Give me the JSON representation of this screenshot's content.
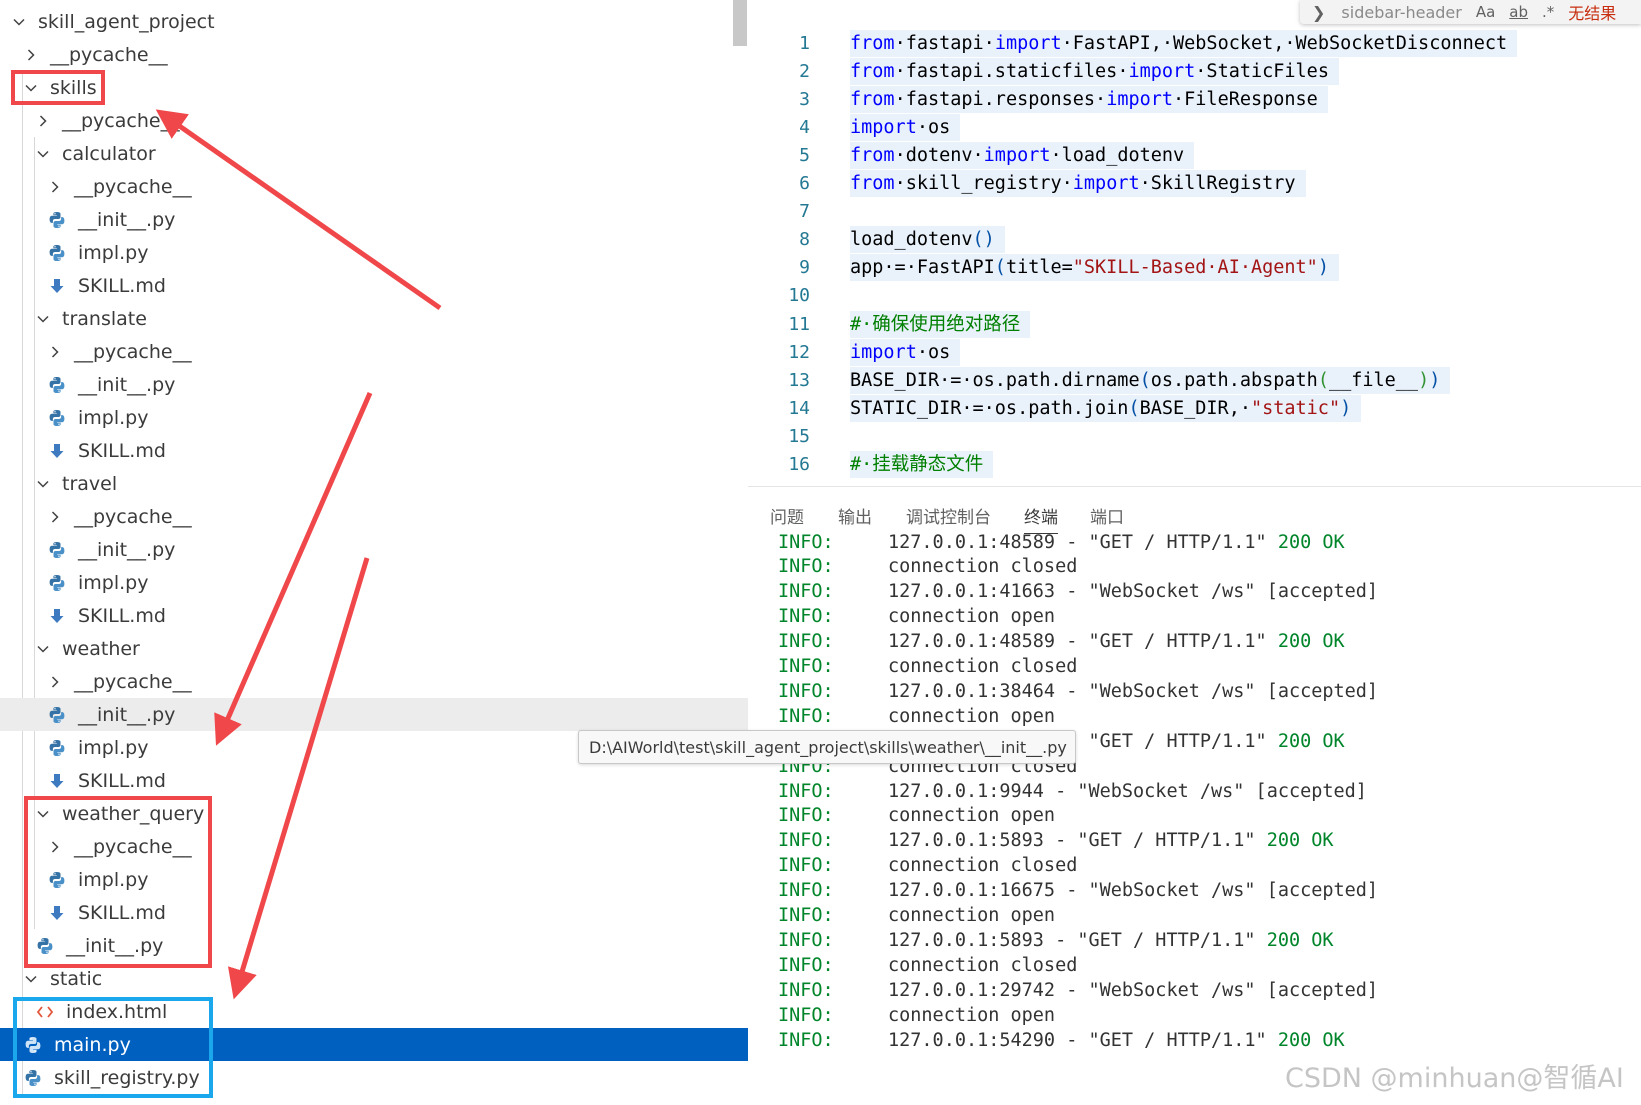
{
  "explorer": {
    "items": [
      {
        "label": "skill_agent_project",
        "type": "folder",
        "expanded": true
      },
      {
        "label": "__pycache__",
        "type": "folder",
        "expanded": false
      },
      {
        "label": "skills",
        "type": "folder",
        "expanded": true
      },
      {
        "label": "__pycache__",
        "type": "folder",
        "expanded": false
      },
      {
        "label": "calculator",
        "type": "folder",
        "expanded": true
      },
      {
        "label": "__pycache__",
        "type": "folder",
        "expanded": false
      },
      {
        "label": "__init__.py",
        "type": "python"
      },
      {
        "label": "impl.py",
        "type": "python"
      },
      {
        "label": "SKILL.md",
        "type": "markdown"
      },
      {
        "label": "translate",
        "type": "folder",
        "expanded": true
      },
      {
        "label": "__pycache__",
        "type": "folder",
        "expanded": false
      },
      {
        "label": "__init__.py",
        "type": "python"
      },
      {
        "label": "impl.py",
        "type": "python"
      },
      {
        "label": "SKILL.md",
        "type": "markdown"
      },
      {
        "label": "travel",
        "type": "folder",
        "expanded": true
      },
      {
        "label": "__pycache__",
        "type": "folder",
        "expanded": false
      },
      {
        "label": "__init__.py",
        "type": "python"
      },
      {
        "label": "impl.py",
        "type": "python"
      },
      {
        "label": "SKILL.md",
        "type": "markdown"
      },
      {
        "label": "weather",
        "type": "folder",
        "expanded": true
      },
      {
        "label": "__pycache__",
        "type": "folder",
        "expanded": false
      },
      {
        "label": "__init__.py",
        "type": "python",
        "hovered": true
      },
      {
        "label": "impl.py",
        "type": "python"
      },
      {
        "label": "SKILL.md",
        "type": "markdown"
      },
      {
        "label": "weather_query",
        "type": "folder",
        "expanded": true
      },
      {
        "label": "__pycache__",
        "type": "folder",
        "expanded": false
      },
      {
        "label": "impl.py",
        "type": "python"
      },
      {
        "label": "SKILL.md",
        "type": "markdown"
      },
      {
        "label": "__init__.py",
        "type": "python"
      },
      {
        "label": "static",
        "type": "folder",
        "expanded": true
      },
      {
        "label": "index.html",
        "type": "html"
      },
      {
        "label": "main.py",
        "type": "python",
        "selected": true
      },
      {
        "label": "skill_registry.py",
        "type": "python"
      }
    ],
    "tooltip": "D:\\AIWorld\\test\\skill_agent_project\\skills\\weather\\__init__.py"
  },
  "find_widget": {
    "input": "sidebar-header",
    "match_case": "Aa",
    "whole_word": "ab",
    "regex": ".*",
    "status": "无结果"
  },
  "editor": {
    "lines": [
      {
        "n": "1",
        "tokens": [
          [
            "kw",
            "from"
          ],
          [
            "",
            "·fastapi·"
          ],
          [
            "kw",
            "import"
          ],
          [
            "",
            "·FastAPI,·WebSocket,·WebSocketDisconnect"
          ]
        ]
      },
      {
        "n": "2",
        "tokens": [
          [
            "kw",
            "from"
          ],
          [
            "",
            "·fastapi.staticfiles·"
          ],
          [
            "kw",
            "import"
          ],
          [
            "",
            "·StaticFiles"
          ]
        ]
      },
      {
        "n": "3",
        "tokens": [
          [
            "kw",
            "from"
          ],
          [
            "",
            "·fastapi.responses·"
          ],
          [
            "kw",
            "import"
          ],
          [
            "",
            "·FileResponse"
          ]
        ]
      },
      {
        "n": "4",
        "tokens": [
          [
            "kw",
            "import"
          ],
          [
            "",
            "·os"
          ]
        ]
      },
      {
        "n": "5",
        "tokens": [
          [
            "kw",
            "from"
          ],
          [
            "",
            "·dotenv·"
          ],
          [
            "kw",
            "import"
          ],
          [
            "",
            "·load_dotenv"
          ]
        ]
      },
      {
        "n": "6",
        "tokens": [
          [
            "kw",
            "from"
          ],
          [
            "",
            "·skill_registry·"
          ],
          [
            "kw",
            "import"
          ],
          [
            "",
            "·SkillRegistry"
          ]
        ]
      },
      {
        "n": "7",
        "tokens": []
      },
      {
        "n": "8",
        "tokens": [
          [
            "",
            "load_dotenv"
          ],
          [
            "par",
            "()"
          ]
        ]
      },
      {
        "n": "9",
        "tokens": [
          [
            "",
            "app·=·FastAPI"
          ],
          [
            "par",
            "("
          ],
          [
            "",
            "title="
          ],
          [
            "str",
            "\"SKILL-Based·AI·Agent\""
          ],
          [
            "par",
            ")"
          ]
        ]
      },
      {
        "n": "10",
        "tokens": []
      },
      {
        "n": "11",
        "tokens": [
          [
            "cm",
            "#·确保使用绝对路径"
          ]
        ]
      },
      {
        "n": "12",
        "tokens": [
          [
            "kw",
            "import"
          ],
          [
            "",
            "·os"
          ]
        ]
      },
      {
        "n": "13",
        "tokens": [
          [
            "",
            "BASE_DIR·=·os.path.dirname"
          ],
          [
            "par",
            "("
          ],
          [
            "",
            "os.path.abspath"
          ],
          [
            "par2",
            "("
          ],
          [
            "",
            "__file__"
          ],
          [
            "par2",
            ")"
          ],
          [
            "par",
            ")"
          ]
        ]
      },
      {
        "n": "14",
        "tokens": [
          [
            "",
            "STATIC_DIR·=·os.path.join"
          ],
          [
            "par",
            "("
          ],
          [
            "",
            "BASE_DIR,·"
          ],
          [
            "str",
            "\"static\""
          ],
          [
            "par",
            ")"
          ]
        ]
      },
      {
        "n": "15",
        "tokens": []
      },
      {
        "n": "16",
        "tokens": [
          [
            "cm",
            "#·挂载静态文件"
          ]
        ]
      }
    ]
  },
  "panel": {
    "tabs": [
      "问题",
      "输出",
      "调试控制台",
      "终端",
      "端口"
    ],
    "active_tab": "终端",
    "logs": [
      {
        "level": "INFO:",
        "text": "127.0.0.1:48589 - \"GET / HTTP/1.1\" ",
        "status": "200 OK"
      },
      {
        "level": "INFO:",
        "text": "connection closed",
        "status": ""
      },
      {
        "level": "INFO:",
        "text": "127.0.0.1:41663 - \"WebSocket /ws\" [accepted]",
        "status": ""
      },
      {
        "level": "INFO:",
        "text": "connection open",
        "status": ""
      },
      {
        "level": "INFO:",
        "text": "127.0.0.1:48589 - \"GET / HTTP/1.1\" ",
        "status": "200 OK"
      },
      {
        "level": "INFO:",
        "text": "connection closed",
        "status": ""
      },
      {
        "level": "INFO:",
        "text": "127.0.0.1:38464 - \"WebSocket /ws\" [accepted]",
        "status": ""
      },
      {
        "level": "INFO:",
        "text": "connection open",
        "status": ""
      },
      {
        "level": "INFO:",
        "text": "127.0.0.1:48671 - \"GET / HTTP/1.1\" ",
        "status": "200 OK"
      },
      {
        "level": "INFO:",
        "text": "connection closed",
        "status": ""
      },
      {
        "level": "INFO:",
        "text": "127.0.0.1:9944 - \"WebSocket /ws\" [accepted]",
        "status": ""
      },
      {
        "level": "INFO:",
        "text": "connection open",
        "status": ""
      },
      {
        "level": "INFO:",
        "text": "127.0.0.1:5893 - \"GET / HTTP/1.1\" ",
        "status": "200 OK"
      },
      {
        "level": "INFO:",
        "text": "connection closed",
        "status": ""
      },
      {
        "level": "INFO:",
        "text": "127.0.0.1:16675 - \"WebSocket /ws\" [accepted]",
        "status": ""
      },
      {
        "level": "INFO:",
        "text": "connection open",
        "status": ""
      },
      {
        "level": "INFO:",
        "text": "127.0.0.1:5893 - \"GET / HTTP/1.1\" ",
        "status": "200 OK"
      },
      {
        "level": "INFO:",
        "text": "connection closed",
        "status": ""
      },
      {
        "level": "INFO:",
        "text": "127.0.0.1:29742 - \"WebSocket /ws\" [accepted]",
        "status": ""
      },
      {
        "level": "INFO:",
        "text": "connection open",
        "status": ""
      },
      {
        "level": "INFO:",
        "text": "127.0.0.1:54290 - \"GET / HTTP/1.1\" ",
        "status": "200 OK"
      }
    ]
  },
  "watermark": "CSDN @minhuan@智循AI",
  "colors": {
    "annotation_red": "#f0484a",
    "annotation_blue": "#1aa7ec",
    "selection": "#0060c0",
    "keyword": "#0000ff",
    "string": "#a31515",
    "comment": "#008000",
    "log_level": "#00852b"
  }
}
